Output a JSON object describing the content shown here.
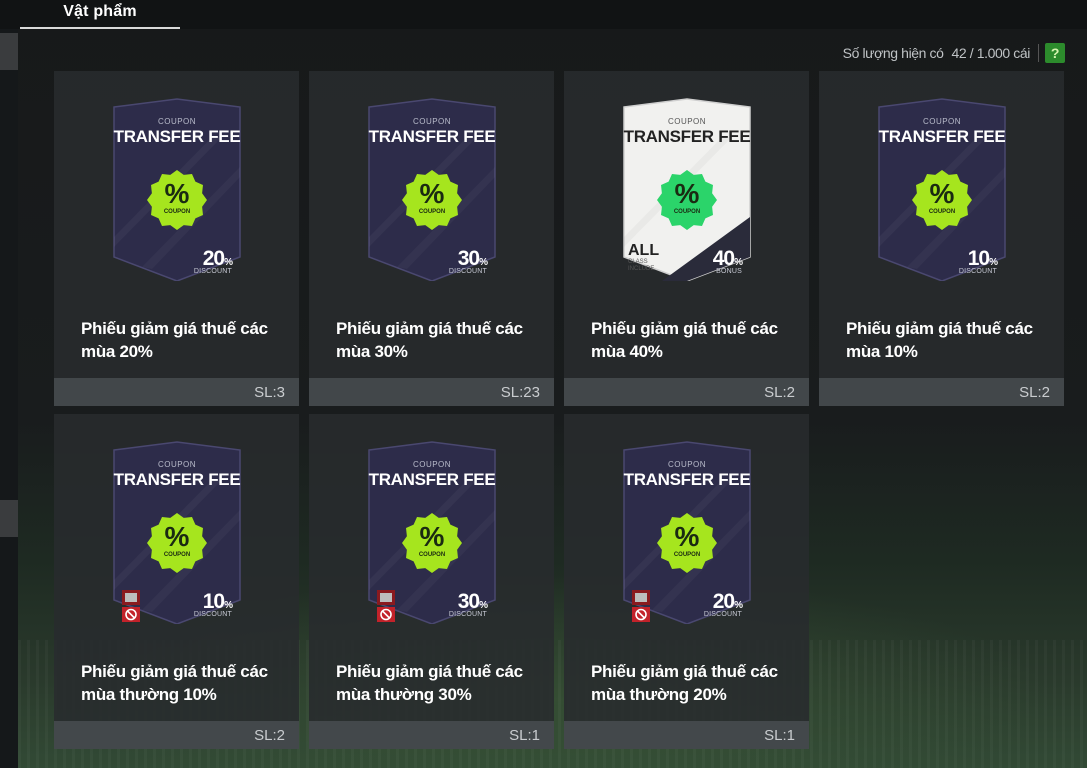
{
  "header": {
    "tab_label": "Vật phẩm"
  },
  "stock": {
    "label": "Số lượng hiện có",
    "value": "42 / 1.000 cái",
    "help_label": "?"
  },
  "items": [
    {
      "coupon": "COUPON",
      "fee": "TRANSFER FEE",
      "badge_pct": "%",
      "badge_text": "COUPON",
      "discount_num": "20",
      "discount_pct": "%",
      "discount_label": "DISCOUNT",
      "title": "Phiếu giảm giá thuế các mùa 20%",
      "qty": "SL:3",
      "style": "dark",
      "locked": false
    },
    {
      "coupon": "COUPON",
      "fee": "TRANSFER FEE",
      "badge_pct": "%",
      "badge_text": "COUPON",
      "discount_num": "30",
      "discount_pct": "%",
      "discount_label": "DISCOUNT",
      "title": "Phiếu giảm giá thuế các mùa 30%",
      "qty": "SL:23",
      "style": "dark",
      "locked": false
    },
    {
      "coupon": "COUPON",
      "fee": "TRANSFER FEE",
      "badge_pct": "%",
      "badge_text": "COUPON",
      "discount_num": "40",
      "discount_pct": "%",
      "discount_label": "BONUS",
      "all_label": "ALL",
      "all_sub1": "CLASS",
      "all_sub2": "INCLUDE",
      "title": "Phiếu giảm giá thuế các mùa 40%",
      "qty": "SL:2",
      "style": "light",
      "locked": false
    },
    {
      "coupon": "COUPON",
      "fee": "TRANSFER FEE",
      "badge_pct": "%",
      "badge_text": "COUPON",
      "discount_num": "10",
      "discount_pct": "%",
      "discount_label": "DISCOUNT",
      "title": "Phiếu giảm giá thuế các mùa 10%",
      "qty": "SL:2",
      "style": "dark",
      "locked": false
    },
    {
      "coupon": "COUPON",
      "fee": "TRANSFER FEE",
      "badge_pct": "%",
      "badge_text": "COUPON",
      "discount_num": "10",
      "discount_pct": "%",
      "discount_label": "DISCOUNT",
      "title": "Phiếu giảm giá thuế các mùa thường 10%",
      "qty": "SL:2",
      "style": "dark",
      "locked": true
    },
    {
      "coupon": "COUPON",
      "fee": "TRANSFER FEE",
      "badge_pct": "%",
      "badge_text": "COUPON",
      "discount_num": "30",
      "discount_pct": "%",
      "discount_label": "DISCOUNT",
      "title": "Phiếu giảm giá thuế các mùa thường 30%",
      "qty": "SL:1",
      "style": "dark",
      "locked": true
    },
    {
      "coupon": "COUPON",
      "fee": "TRANSFER FEE",
      "badge_pct": "%",
      "badge_text": "COUPON",
      "discount_num": "20",
      "discount_pct": "%",
      "discount_label": "DISCOUNT",
      "title": "Phiếu giảm giá thuế các mùa thường 20%",
      "qty": "SL:1",
      "style": "dark",
      "locked": true
    }
  ],
  "colors": {
    "badge_lime": "#a6e51e",
    "badge_green": "#2bd46a",
    "card_dark": "#2b2b4a",
    "accent_help": "#2c8b2c"
  }
}
